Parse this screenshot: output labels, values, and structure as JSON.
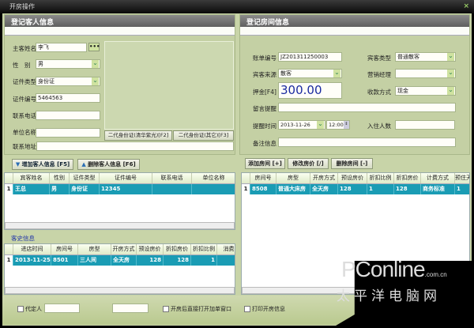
{
  "window": {
    "title": "开房操作",
    "close": "×"
  },
  "guest": {
    "header": "登记客人信息",
    "name_label": "主客姓名",
    "name": "李飞",
    "more": "•••",
    "gender_label": "性　别",
    "gender": "男",
    "idtype_label": "证件类型",
    "idtype": "身份证",
    "idno_label": "证件编号",
    "idno": "5464563",
    "phone_label": "联系电话",
    "company_label": "单位名称",
    "address_label": "联系地址",
    "id_btn1": "二代身份证(清华紫光)[F2]",
    "id_btn2": "二代身份证(其它)[F3]",
    "add_btn": "增加客人信息 [F5]",
    "del_btn": "删除客人信息 [F6]",
    "columns": [
      "宾客姓名",
      "性别",
      "证件类型",
      "证件编号",
      "联系电话",
      "单位名称"
    ],
    "rows": [
      [
        "1",
        "王总",
        "男",
        "身份证",
        "12345",
        "",
        ""
      ]
    ]
  },
  "history": {
    "title": "客史信息",
    "columns": [
      "进店时间",
      "房间号",
      "房型",
      "开房方式",
      "预设房价",
      "折扣房价",
      "折扣比例",
      "消费"
    ],
    "rows": [
      [
        "1",
        "2013-11-25",
        "8501",
        "三人间",
        "全天房",
        "128",
        "128",
        "1",
        ""
      ]
    ]
  },
  "room": {
    "header": "登记房间信息",
    "bill_label": "账单编号",
    "bill": "JZ201311250003",
    "guesttype_label": "宾客类型",
    "guesttype": "普通散客",
    "source_label": "宾客来源",
    "source": "散客",
    "manager_label": "营销经理",
    "manager": "",
    "deposit_label": "押金[F4]",
    "deposit": "300.00",
    "pay_label": "收款方式",
    "pay": "现金",
    "msg_label": "留言提醒",
    "remind_label": "提醒时间",
    "remind_date": "2013-11-26",
    "remind_time": "12:00",
    "persons_label": "入住人数",
    "note_label": "备注信息",
    "add_btn": "添加房间 [+]",
    "edit_btn": "修改房价 [/]",
    "del_btn": "删除房间 [-]",
    "columns": [
      "房间号",
      "房型",
      "开房方式",
      "预设房价",
      "折扣比例",
      "折扣房价",
      "计费方式",
      "预住天"
    ],
    "rows": [
      [
        "1",
        "8508",
        "普通大床房",
        "全天房",
        "128",
        "1",
        "128",
        "商务标准",
        "1"
      ]
    ]
  },
  "footer": {
    "agent_label": "代定人",
    "open_add_label": "开房后直接打开加单窗口",
    "print_label": "打印开房信息"
  },
  "watermark": {
    "brand": "PConline",
    "domain": ".com.cn",
    "cn": "太平洋电脑网"
  }
}
